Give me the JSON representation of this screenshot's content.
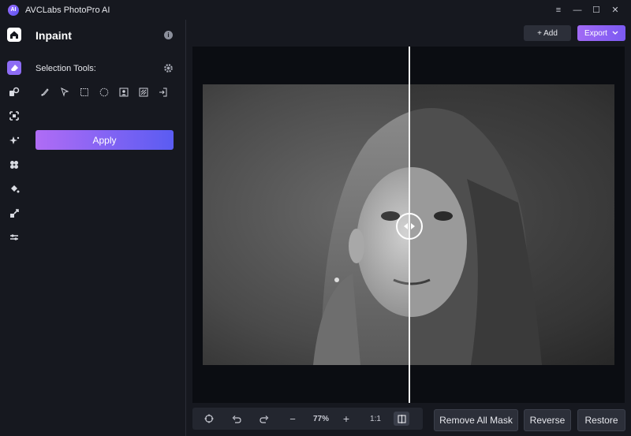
{
  "app": {
    "title": "AVCLabs PhotoPro AI",
    "logo_text": "AI"
  },
  "window": {
    "menu_icon": "≡",
    "minimize_icon": "—",
    "maximize_icon": "☐",
    "close_icon": "✕"
  },
  "panel": {
    "title": "Inpaint",
    "selection_label": "Selection Tools:",
    "apply_label": "Apply"
  },
  "header": {
    "add_label": "+ Add",
    "export_label": "Export"
  },
  "zoom": {
    "level": "77%",
    "fit_label": "1:1"
  },
  "actions": {
    "remove_all_mask": "Remove All Mask",
    "reverse": "Reverse",
    "restore": "Restore"
  },
  "colors": {
    "accent_start": "#b06cf5",
    "accent_end": "#5a5cf2",
    "background": "#16181f"
  }
}
